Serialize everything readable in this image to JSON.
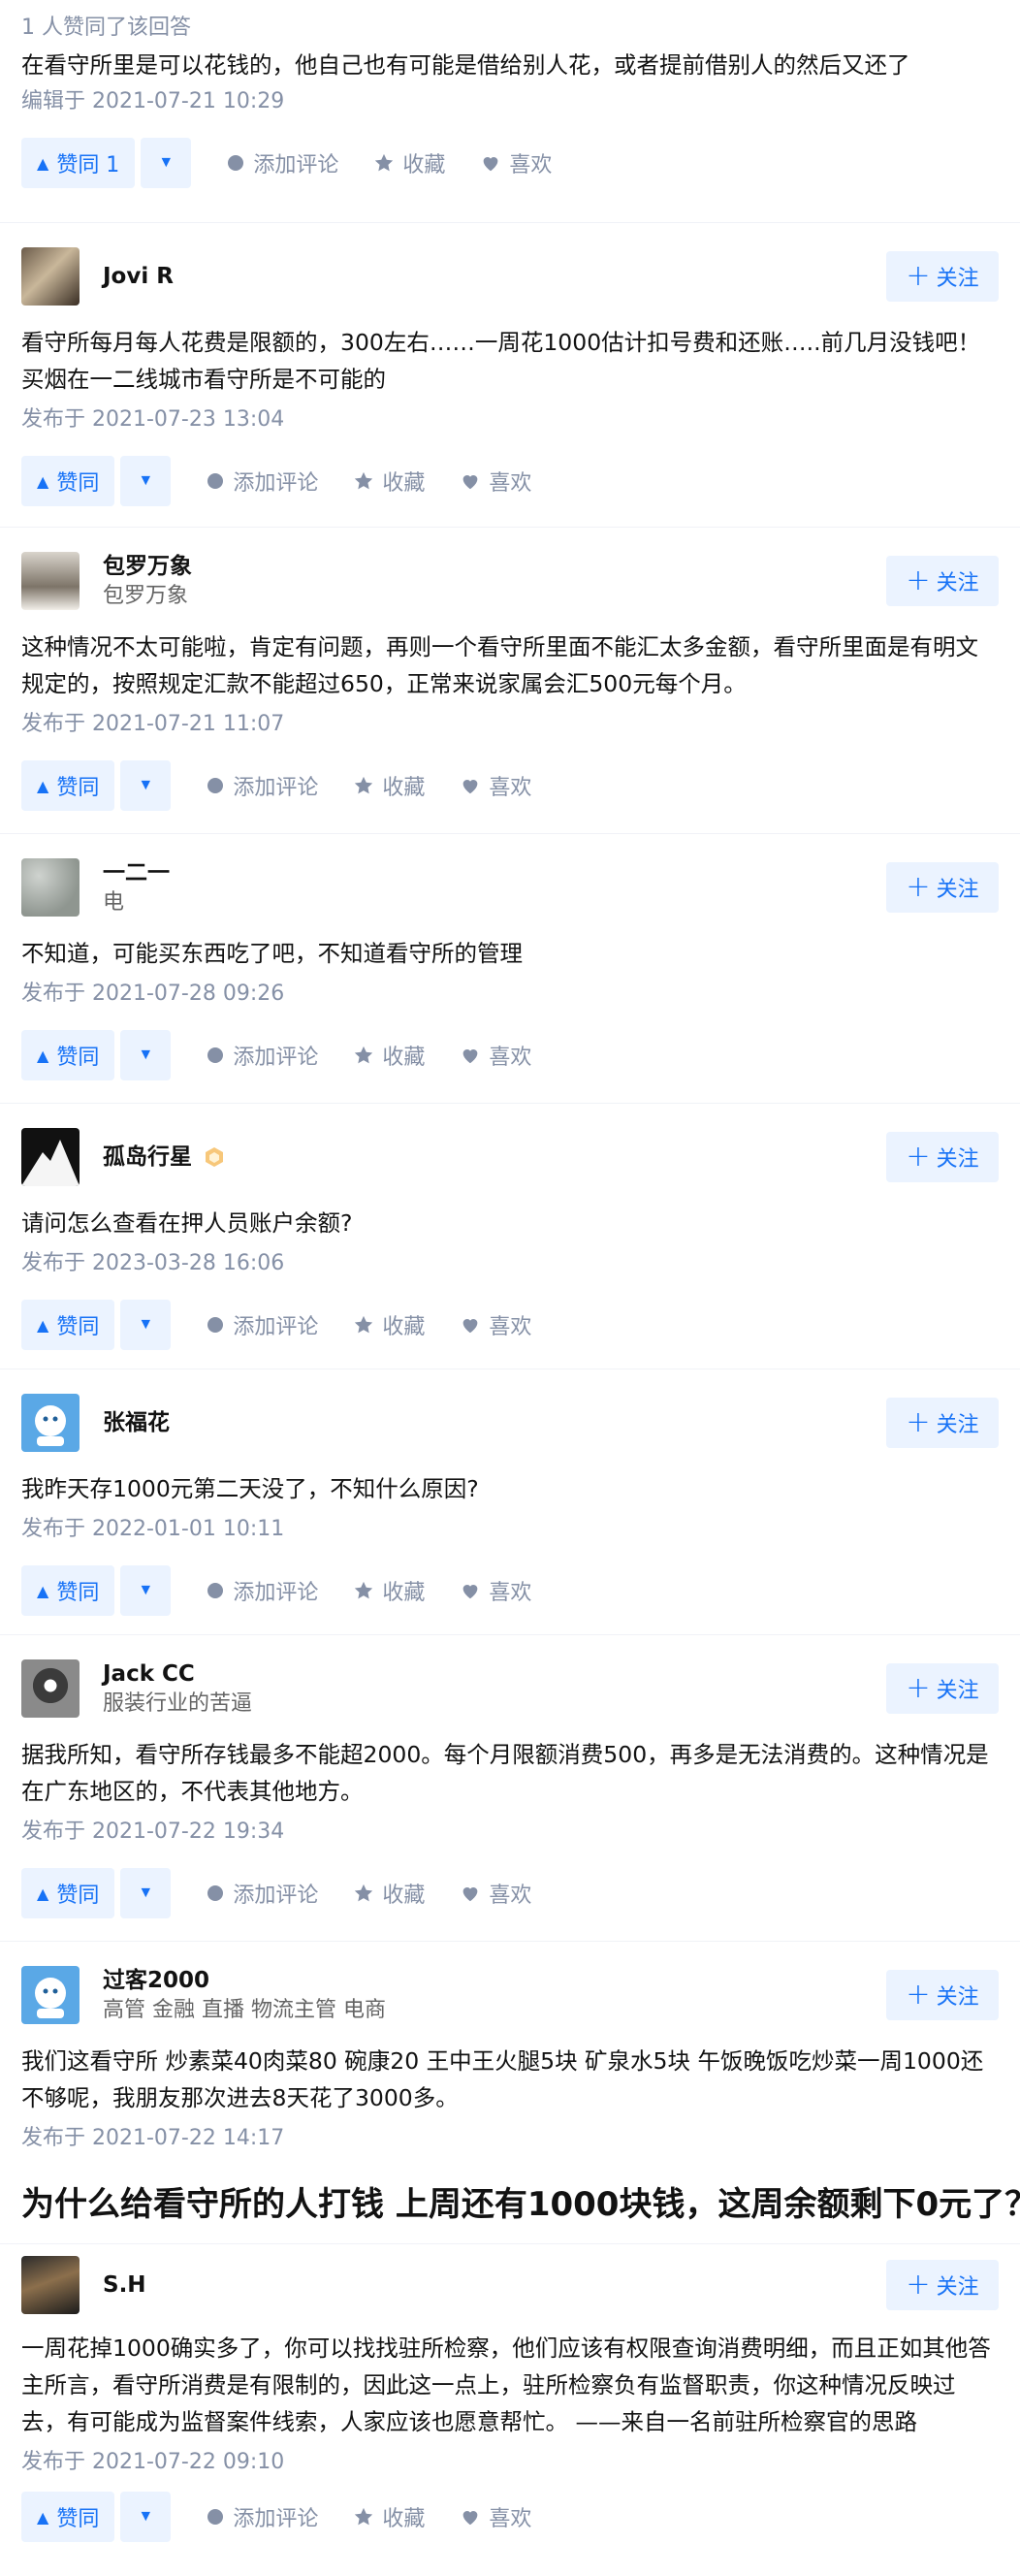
{
  "answers": [
    {
      "vote_summary": "1 人赞同了该回答",
      "content": "在看守所里是可以花钱的，他自己也有可能是借给别人花，或者提前借别人的然后又还了",
      "time": "编辑于 2021-07-21 10:29",
      "vote_label": "赞同 1"
    },
    {
      "author": {
        "name": "Jovi R",
        "bio": ""
      },
      "content": "看守所每月每人花费是限额的，300左右……一周花1000估计扣号费和还账…..前几月没钱吧！买烟在一二线城市看守所是不可能的",
      "time": "发布于 2021-07-23 13:04",
      "vote_label": "赞同"
    },
    {
      "author": {
        "name": "包罗万象",
        "bio": "包罗万象"
      },
      "content": "这种情况不太可能啦，肯定有问题，再则一个看守所里面不能汇太多金额，看守所里面是有明文规定的，按照规定汇款不能超过650，正常来说家属会汇500元每个月。",
      "time": "发布于 2021-07-21 11:07",
      "vote_label": "赞同"
    },
    {
      "author": {
        "name": "一二一",
        "bio": "电"
      },
      "content": "不知道，可能买东西吃了吧，不知道看守所的管理",
      "time": "发布于 2021-07-28 09:26",
      "vote_label": "赞同"
    },
    {
      "author": {
        "name": "孤岛行星",
        "bio": ""
      },
      "content": "请问怎么查看在押人员账户余额?",
      "time": "发布于 2023-03-28 16:06",
      "vote_label": "赞同"
    },
    {
      "author": {
        "name": "张福花",
        "bio": ""
      },
      "content": "我昨天存1000元第二天没了，不知什么原因?",
      "time": "发布于 2022-01-01 10:11",
      "vote_label": "赞同"
    },
    {
      "author": {
        "name": "Jack CC",
        "bio": "服装行业的苦逼"
      },
      "content": "据我所知，看守所存钱最多不能超2000。每个月限额消费500，再多是无法消费的。这种情况是在广东地区的，不代表其他地方。",
      "time": "发布于 2021-07-22 19:34",
      "vote_label": "赞同"
    },
    {
      "author": {
        "name": "过客2000",
        "bio": "高管 金融 直播 物流主管 电商"
      },
      "content": "我们这看守所 炒素菜40肉菜80 碗康20 王中王火腿5块 矿泉水5块 午饭晚饭吃炒菜一周1000还不够呢，我朋友那次进去8天花了3000多。",
      "time": "发布于 2021-07-22 14:17",
      "vote_label": "赞同"
    },
    {
      "author": {
        "name": "S.H",
        "bio": ""
      },
      "content": "一周花掉1000确实多了，你可以找找驻所检察，他们应该有权限查询消费明细，而且正如其他答主所言，看守所消费是有限制的，因此这一点上，驻所检察负有监督职责，你这种情况反映过去，有可能成为监督案件线索，人家应该也愿意帮忙。 ——来自一名前驻所检察官的思路",
      "time": "发布于 2021-07-22 09:10",
      "vote_label": "赞同"
    }
  ],
  "question_title": "为什么给看守所的人打钱 上周还有1000块钱，这周余额剩下0元了？",
  "labels": {
    "follow": "关注",
    "comment": "添加评论",
    "favorite": "收藏",
    "like": "喜欢"
  },
  "colors": {
    "accent": "#1772f6",
    "accent_bg": "#ebf3ff",
    "meta": "#8590a6"
  }
}
